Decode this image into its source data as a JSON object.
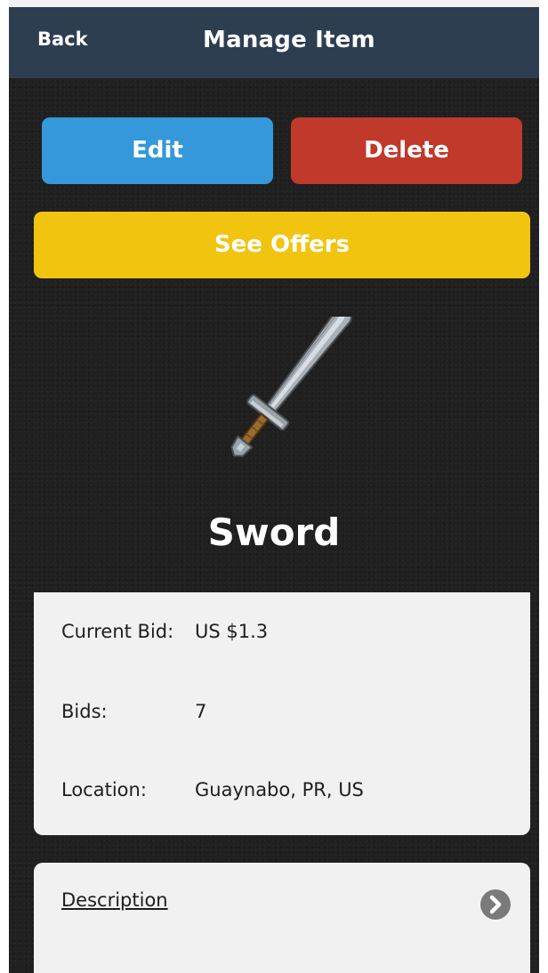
{
  "navbar": {
    "back_label": "Back",
    "title": "Manage Item"
  },
  "actions": {
    "edit_label": "Edit",
    "delete_label": "Delete",
    "offers_label": "See Offers"
  },
  "item": {
    "image_icon": "sword-icon",
    "name": "Sword"
  },
  "info": {
    "current_bid_label": "Current Bid:",
    "current_bid_value": "US $1.3",
    "bids_label": "Bids:",
    "bids_value": "7",
    "location_label": "Location:",
    "location_value": "Guaynabo, PR, US"
  },
  "description": {
    "link_label": "Description",
    "expand_icon": "chevron-right-icon"
  },
  "colors": {
    "navbar": "#2c3e50",
    "edit": "#3498db",
    "delete": "#c0392b",
    "offers": "#f1c40f",
    "card": "#f1f1f1"
  }
}
